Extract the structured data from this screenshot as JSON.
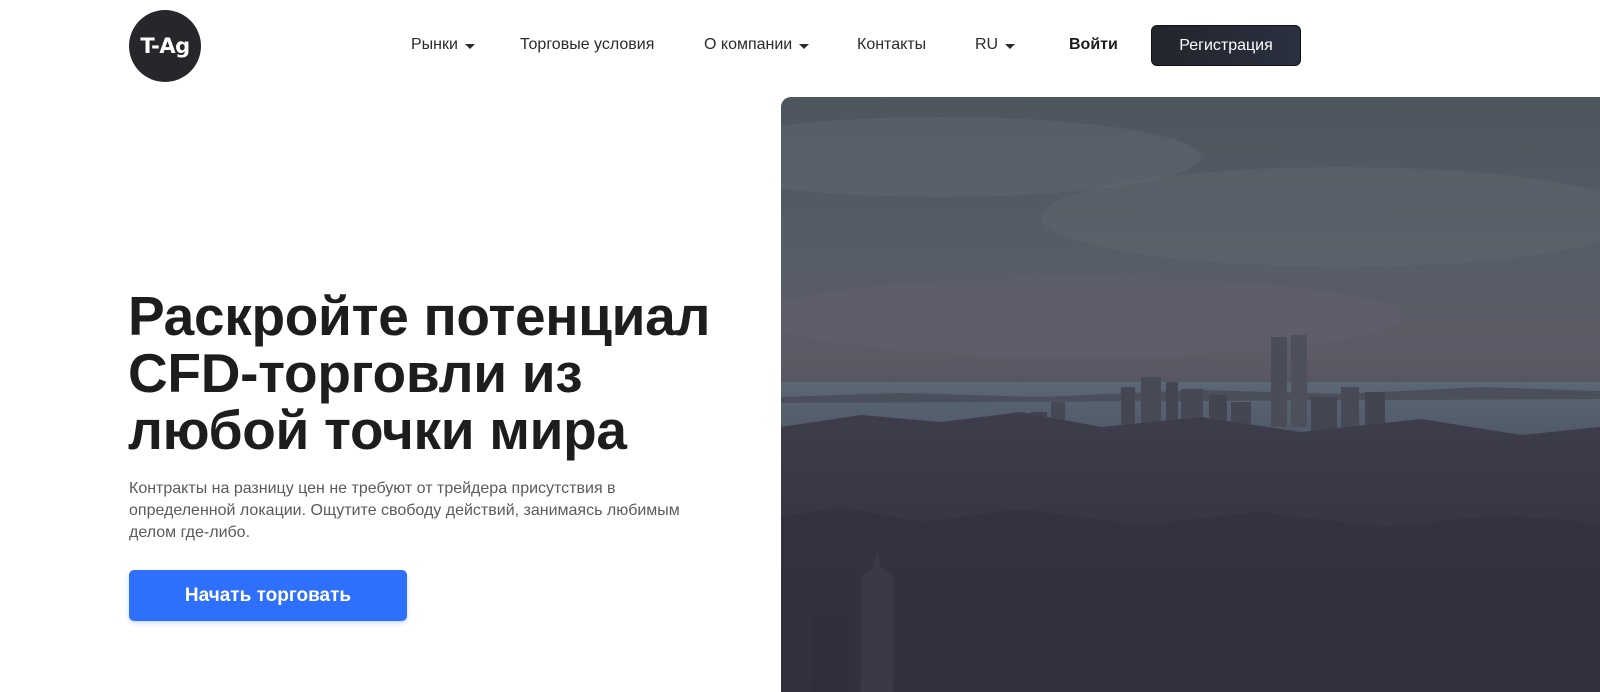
{
  "brand": {
    "logo_text": "T-Ag"
  },
  "nav": {
    "items": [
      {
        "label": "Рынки",
        "dropdown": true
      },
      {
        "label": "Торговые условия",
        "dropdown": false
      },
      {
        "label": "О компании",
        "dropdown": true
      },
      {
        "label": "Контакты",
        "dropdown": false
      },
      {
        "label": "RU",
        "dropdown": true
      }
    ],
    "login_label": "Войти",
    "register_label": "Регистрация"
  },
  "hero": {
    "title_lines": [
      "Раскройте потенциал",
      "CFD-торговли из",
      "любой точки мира"
    ],
    "description_lines": [
      "Контракты на разницу цен не требуют от трейдера присутствия в",
      "определенной локации. Ощутите свободу действий, занимаясь любимым",
      "делом где-либо."
    ],
    "cta_label": "Начать торговать",
    "image": "city-skyline-photo"
  },
  "colors": {
    "primary": "#2e6ffb",
    "dark": "#27272b",
    "text": "#1d1d1f",
    "muted": "#5a5a5f"
  }
}
